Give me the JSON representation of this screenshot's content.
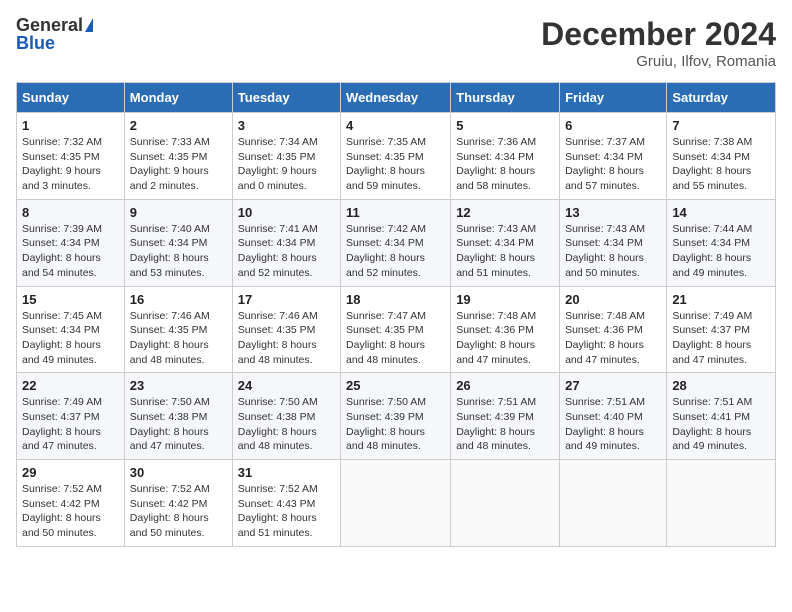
{
  "header": {
    "logo_general": "General",
    "logo_blue": "Blue",
    "title": "December 2024",
    "subtitle": "Gruiu, Ilfov, Romania"
  },
  "weekdays": [
    "Sunday",
    "Monday",
    "Tuesday",
    "Wednesday",
    "Thursday",
    "Friday",
    "Saturday"
  ],
  "weeks": [
    [
      {
        "day": "1",
        "sunrise": "Sunrise: 7:32 AM",
        "sunset": "Sunset: 4:35 PM",
        "daylight": "Daylight: 9 hours and 3 minutes."
      },
      {
        "day": "2",
        "sunrise": "Sunrise: 7:33 AM",
        "sunset": "Sunset: 4:35 PM",
        "daylight": "Daylight: 9 hours and 2 minutes."
      },
      {
        "day": "3",
        "sunrise": "Sunrise: 7:34 AM",
        "sunset": "Sunset: 4:35 PM",
        "daylight": "Daylight: 9 hours and 0 minutes."
      },
      {
        "day": "4",
        "sunrise": "Sunrise: 7:35 AM",
        "sunset": "Sunset: 4:35 PM",
        "daylight": "Daylight: 8 hours and 59 minutes."
      },
      {
        "day": "5",
        "sunrise": "Sunrise: 7:36 AM",
        "sunset": "Sunset: 4:34 PM",
        "daylight": "Daylight: 8 hours and 58 minutes."
      },
      {
        "day": "6",
        "sunrise": "Sunrise: 7:37 AM",
        "sunset": "Sunset: 4:34 PM",
        "daylight": "Daylight: 8 hours and 57 minutes."
      },
      {
        "day": "7",
        "sunrise": "Sunrise: 7:38 AM",
        "sunset": "Sunset: 4:34 PM",
        "daylight": "Daylight: 8 hours and 55 minutes."
      }
    ],
    [
      {
        "day": "8",
        "sunrise": "Sunrise: 7:39 AM",
        "sunset": "Sunset: 4:34 PM",
        "daylight": "Daylight: 8 hours and 54 minutes."
      },
      {
        "day": "9",
        "sunrise": "Sunrise: 7:40 AM",
        "sunset": "Sunset: 4:34 PM",
        "daylight": "Daylight: 8 hours and 53 minutes."
      },
      {
        "day": "10",
        "sunrise": "Sunrise: 7:41 AM",
        "sunset": "Sunset: 4:34 PM",
        "daylight": "Daylight: 8 hours and 52 minutes."
      },
      {
        "day": "11",
        "sunrise": "Sunrise: 7:42 AM",
        "sunset": "Sunset: 4:34 PM",
        "daylight": "Daylight: 8 hours and 52 minutes."
      },
      {
        "day": "12",
        "sunrise": "Sunrise: 7:43 AM",
        "sunset": "Sunset: 4:34 PM",
        "daylight": "Daylight: 8 hours and 51 minutes."
      },
      {
        "day": "13",
        "sunrise": "Sunrise: 7:43 AM",
        "sunset": "Sunset: 4:34 PM",
        "daylight": "Daylight: 8 hours and 50 minutes."
      },
      {
        "day": "14",
        "sunrise": "Sunrise: 7:44 AM",
        "sunset": "Sunset: 4:34 PM",
        "daylight": "Daylight: 8 hours and 49 minutes."
      }
    ],
    [
      {
        "day": "15",
        "sunrise": "Sunrise: 7:45 AM",
        "sunset": "Sunset: 4:34 PM",
        "daylight": "Daylight: 8 hours and 49 minutes."
      },
      {
        "day": "16",
        "sunrise": "Sunrise: 7:46 AM",
        "sunset": "Sunset: 4:35 PM",
        "daylight": "Daylight: 8 hours and 48 minutes."
      },
      {
        "day": "17",
        "sunrise": "Sunrise: 7:46 AM",
        "sunset": "Sunset: 4:35 PM",
        "daylight": "Daylight: 8 hours and 48 minutes."
      },
      {
        "day": "18",
        "sunrise": "Sunrise: 7:47 AM",
        "sunset": "Sunset: 4:35 PM",
        "daylight": "Daylight: 8 hours and 48 minutes."
      },
      {
        "day": "19",
        "sunrise": "Sunrise: 7:48 AM",
        "sunset": "Sunset: 4:36 PM",
        "daylight": "Daylight: 8 hours and 47 minutes."
      },
      {
        "day": "20",
        "sunrise": "Sunrise: 7:48 AM",
        "sunset": "Sunset: 4:36 PM",
        "daylight": "Daylight: 8 hours and 47 minutes."
      },
      {
        "day": "21",
        "sunrise": "Sunrise: 7:49 AM",
        "sunset": "Sunset: 4:37 PM",
        "daylight": "Daylight: 8 hours and 47 minutes."
      }
    ],
    [
      {
        "day": "22",
        "sunrise": "Sunrise: 7:49 AM",
        "sunset": "Sunset: 4:37 PM",
        "daylight": "Daylight: 8 hours and 47 minutes."
      },
      {
        "day": "23",
        "sunrise": "Sunrise: 7:50 AM",
        "sunset": "Sunset: 4:38 PM",
        "daylight": "Daylight: 8 hours and 47 minutes."
      },
      {
        "day": "24",
        "sunrise": "Sunrise: 7:50 AM",
        "sunset": "Sunset: 4:38 PM",
        "daylight": "Daylight: 8 hours and 48 minutes."
      },
      {
        "day": "25",
        "sunrise": "Sunrise: 7:50 AM",
        "sunset": "Sunset: 4:39 PM",
        "daylight": "Daylight: 8 hours and 48 minutes."
      },
      {
        "day": "26",
        "sunrise": "Sunrise: 7:51 AM",
        "sunset": "Sunset: 4:39 PM",
        "daylight": "Daylight: 8 hours and 48 minutes."
      },
      {
        "day": "27",
        "sunrise": "Sunrise: 7:51 AM",
        "sunset": "Sunset: 4:40 PM",
        "daylight": "Daylight: 8 hours and 49 minutes."
      },
      {
        "day": "28",
        "sunrise": "Sunrise: 7:51 AM",
        "sunset": "Sunset: 4:41 PM",
        "daylight": "Daylight: 8 hours and 49 minutes."
      }
    ],
    [
      {
        "day": "29",
        "sunrise": "Sunrise: 7:52 AM",
        "sunset": "Sunset: 4:42 PM",
        "daylight": "Daylight: 8 hours and 50 minutes."
      },
      {
        "day": "30",
        "sunrise": "Sunrise: 7:52 AM",
        "sunset": "Sunset: 4:42 PM",
        "daylight": "Daylight: 8 hours and 50 minutes."
      },
      {
        "day": "31",
        "sunrise": "Sunrise: 7:52 AM",
        "sunset": "Sunset: 4:43 PM",
        "daylight": "Daylight: 8 hours and 51 minutes."
      },
      null,
      null,
      null,
      null
    ]
  ]
}
